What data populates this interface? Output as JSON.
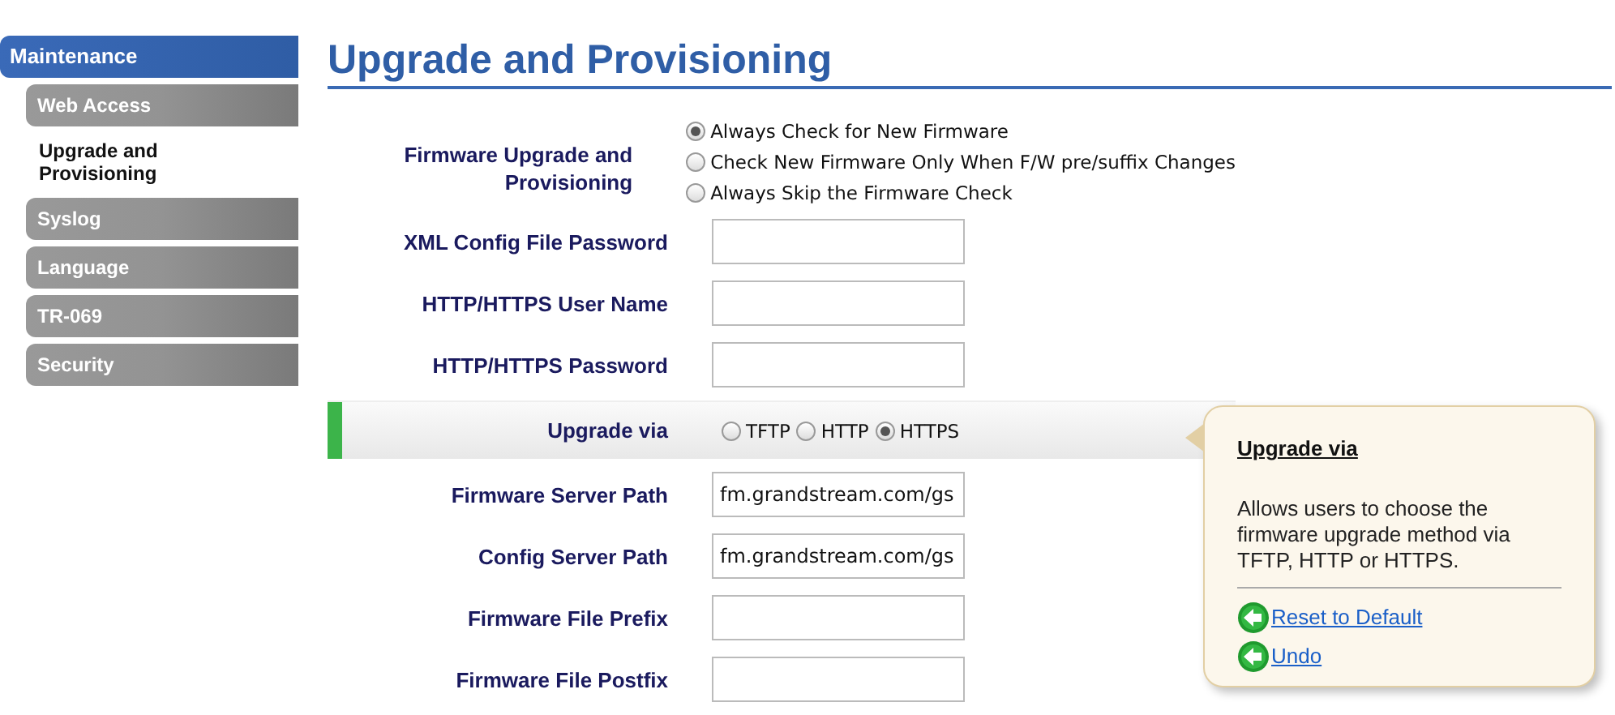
{
  "sidebar": {
    "section": "Maintenance",
    "items": [
      {
        "label": "Web Access",
        "selected": false
      },
      {
        "label": "Upgrade and Provisioning",
        "selected": true
      },
      {
        "label": "Syslog",
        "selected": false
      },
      {
        "label": "Language",
        "selected": false
      },
      {
        "label": "TR-069",
        "selected": false
      },
      {
        "label": "Security",
        "selected": false
      }
    ]
  },
  "page_title": "Upgrade and Provisioning",
  "form": [
    {
      "kind": "radio-stack",
      "label": "Firmware Upgrade and Provisioning",
      "highlighted": false,
      "options": [
        {
          "label": "Always Check for New Firmware",
          "selected": true
        },
        {
          "label": "Check New Firmware Only When F/W pre/suffix Changes",
          "selected": false
        },
        {
          "label": "Always Skip the Firmware Check",
          "selected": false
        }
      ]
    },
    {
      "kind": "field",
      "label": "XML Config File Password",
      "highlighted": false
    },
    {
      "kind": "field",
      "label": "HTTP/HTTPS User Name",
      "highlighted": false
    },
    {
      "kind": "field",
      "label": "HTTP/HTTPS Password",
      "highlighted": false
    },
    {
      "kind": "radio-row",
      "label": "Upgrade via",
      "highlighted": true,
      "options": [
        {
          "label": "TFTP",
          "selected": false
        },
        {
          "label": "HTTP",
          "selected": false
        },
        {
          "label": "HTTPS",
          "selected": true
        }
      ]
    },
    {
      "kind": "field",
      "label": "Firmware Server Path",
      "value": "fm.grandstream.com/gs",
      "highlighted": false
    },
    {
      "kind": "field",
      "label": "Config Server Path",
      "value": "fm.grandstream.com/gs",
      "highlighted": false
    },
    {
      "kind": "field",
      "label": "Firmware File Prefix",
      "highlighted": false
    },
    {
      "kind": "field",
      "label": "Firmware File Postfix",
      "highlighted": false
    }
  ],
  "help_popup": {
    "title": "Upgrade via",
    "text": "Allows users to choose the firmware upgrade method via TFTP, HTTP or HTTPS.",
    "links": [
      "Reset to Default",
      "Undo"
    ]
  }
}
